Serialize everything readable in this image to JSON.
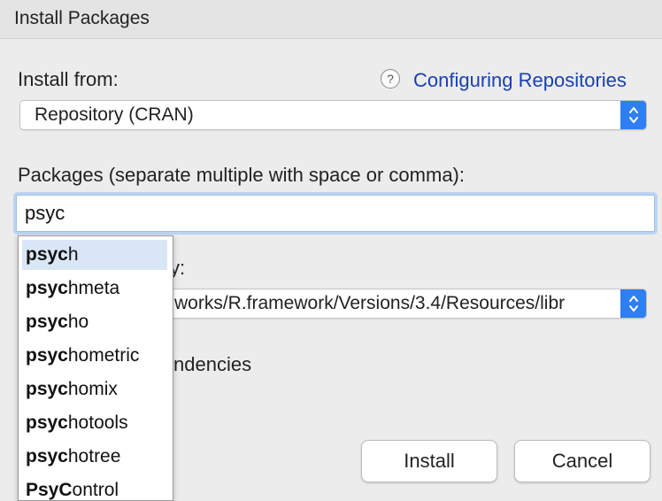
{
  "window": {
    "title": "Install Packages"
  },
  "install_from": {
    "label": "Install from:",
    "help_link": "Configuring Repositories",
    "help_icon": "question-icon",
    "selected": "Repository (CRAN)"
  },
  "packages": {
    "label": "Packages (separate multiple with space or comma):",
    "value": "psyc"
  },
  "library": {
    "label_visible": "y:",
    "selected_visible": "works/R.framework/Versions/3.4/Resources/libr"
  },
  "dependencies": {
    "label_visible": "ndencies"
  },
  "autocomplete": {
    "items": [
      {
        "match": "psyc",
        "rest": "h"
      },
      {
        "match": "psyc",
        "rest": "hmeta"
      },
      {
        "match": "psyc",
        "rest": "ho"
      },
      {
        "match": "psyc",
        "rest": "hometric"
      },
      {
        "match": "psyc",
        "rest": "homix"
      },
      {
        "match": "psyc",
        "rest": "hotools"
      },
      {
        "match": "psyc",
        "rest": "hotree"
      },
      {
        "match": "PsyC",
        "rest": "ontrol"
      }
    ],
    "selected_index": 0
  },
  "buttons": {
    "install": "Install",
    "cancel": "Cancel"
  },
  "colors": {
    "accent": "#2f7ff2",
    "link": "#1a3fb0",
    "selection": "#d9e6f6"
  }
}
